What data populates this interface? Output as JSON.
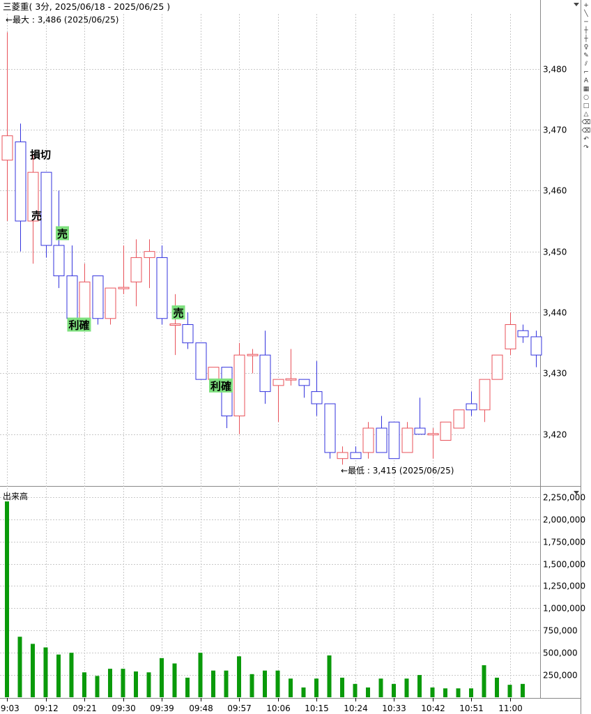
{
  "window": {
    "title": "三菱重( 3分, 2025/06/18 - 2025/06/25 )"
  },
  "colors": {
    "up": "#e8525a",
    "down": "#3333dd",
    "volume": "#0a9a0a",
    "signal_bg": "#7ee07e",
    "grid": "#c8c8c8"
  },
  "toolbar_icons": [
    "plus-icon",
    "line-icon",
    "diagonal-icon",
    "hline-icon",
    "vline-icon",
    "text-icon",
    "pen-icon",
    "channel-icon",
    "box-icon",
    "letter-a-icon",
    "grid-icon",
    "circle-icon",
    "rectangle-icon",
    "triangle-icon",
    "eraser-icon",
    "eraser-all-icon",
    "undo-icon",
    "redo-icon"
  ],
  "chart_data": [
    {
      "type": "candlestick",
      "title": "三菱重( 3分, 2025/06/18 - 2025/06/25 )",
      "y_ticks": [
        "3,480",
        "3,470",
        "3,460",
        "3,450",
        "3,440",
        "3,430",
        "3,420"
      ],
      "y_tick_values": [
        3480,
        3470,
        3460,
        3450,
        3440,
        3430,
        3420
      ],
      "ylim": [
        3411.5,
        3489
      ],
      "x_tick_labels": [
        "09:03",
        "09:12",
        "09:21",
        "09:30",
        "09:39",
        "09:48",
        "09:57",
        "10:06",
        "10:15",
        "10:24",
        "10:33",
        "10:42",
        "10:51",
        "11:00"
      ],
      "x_tick_index": [
        0,
        3,
        6,
        9,
        12,
        15,
        18,
        21,
        24,
        27,
        30,
        33,
        36,
        39
      ],
      "candles": [
        {
          "o": 3465,
          "h": 3486,
          "l": 3455,
          "c": 3469
        },
        {
          "o": 3468,
          "h": 3471,
          "l": 3450,
          "c": 3455
        },
        {
          "o": 3455,
          "h": 3466,
          "l": 3448,
          "c": 3463
        },
        {
          "o": 3463,
          "h": 3463,
          "l": 3449,
          "c": 3451
        },
        {
          "o": 3451,
          "h": 3460,
          "l": 3444,
          "c": 3446
        },
        {
          "o": 3446,
          "h": 3451,
          "l": 3439,
          "c": 3439
        },
        {
          "o": 3439,
          "h": 3448,
          "l": 3439,
          "c": 3445
        },
        {
          "o": 3446,
          "h": 3446,
          "l": 3438,
          "c": 3439
        },
        {
          "o": 3439,
          "h": 3444,
          "l": 3438,
          "c": 3444
        },
        {
          "o": 3444,
          "h": 3451,
          "l": 3443,
          "c": 3444
        },
        {
          "o": 3445,
          "h": 3452,
          "l": 3441,
          "c": 3449
        },
        {
          "o": 3449,
          "h": 3452,
          "l": 3444,
          "c": 3450
        },
        {
          "o": 3449,
          "h": 3451,
          "l": 3438,
          "c": 3439
        },
        {
          "o": 3438,
          "h": 3443,
          "l": 3433,
          "c": 3438
        },
        {
          "o": 3438,
          "h": 3440,
          "l": 3434,
          "c": 3435
        },
        {
          "o": 3435,
          "h": 3435,
          "l": 3429,
          "c": 3429
        },
        {
          "o": 3429,
          "h": 3431,
          "l": 3429,
          "c": 3431
        },
        {
          "o": 3431,
          "h": 3431,
          "l": 3421,
          "c": 3423
        },
        {
          "o": 3423,
          "h": 3435,
          "l": 3420,
          "c": 3433
        },
        {
          "o": 3433,
          "h": 3434,
          "l": 3430,
          "c": 3433
        },
        {
          "o": 3433,
          "h": 3437,
          "l": 3425,
          "c": 3427
        },
        {
          "o": 3428,
          "h": 3429,
          "l": 3422,
          "c": 3429
        },
        {
          "o": 3429,
          "h": 3434,
          "l": 3428,
          "c": 3429
        },
        {
          "o": 3429,
          "h": 3429,
          "l": 3426,
          "c": 3428
        },
        {
          "o": 3427,
          "h": 3432,
          "l": 3423,
          "c": 3425
        },
        {
          "o": 3425,
          "h": 3425,
          "l": 3416,
          "c": 3417
        },
        {
          "o": 3416,
          "h": 3418,
          "l": 3415,
          "c": 3417
        },
        {
          "o": 3417,
          "h": 3418,
          "l": 3416,
          "c": 3416
        },
        {
          "o": 3417,
          "h": 3422,
          "l": 3416,
          "c": 3421
        },
        {
          "o": 3421,
          "h": 3423,
          "l": 3417,
          "c": 3417
        },
        {
          "o": 3422,
          "h": 3422,
          "l": 3416,
          "c": 3416
        },
        {
          "o": 3417,
          "h": 3422,
          "l": 3417,
          "c": 3421
        },
        {
          "o": 3421,
          "h": 3426,
          "l": 3420,
          "c": 3420
        },
        {
          "o": 3420,
          "h": 3421,
          "l": 3416,
          "c": 3420
        },
        {
          "o": 3419,
          "h": 3421,
          "l": 3419,
          "c": 3422
        },
        {
          "o": 3421,
          "h": 3424,
          "l": 3421,
          "c": 3424
        },
        {
          "o": 3425,
          "h": 3427,
          "l": 3423,
          "c": 3424
        },
        {
          "o": 3424,
          "h": 3429,
          "l": 3422,
          "c": 3429
        },
        {
          "o": 3429,
          "h": 3433,
          "l": 3429,
          "c": 3433
        },
        {
          "o": 3434,
          "h": 3440,
          "l": 3433,
          "c": 3438
        },
        {
          "o": 3437,
          "h": 3438,
          "l": 3435,
          "c": 3436
        },
        {
          "o": 3436,
          "h": 3437,
          "l": 3431,
          "c": 3433
        }
      ],
      "annotations": [
        {
          "text": "←最大 : 3,486 (2025/06/25)",
          "candle": 0,
          "value": 3488,
          "kind": "max"
        },
        {
          "text": "←最低 : 3,415 (2025/06/25)",
          "candle": 26,
          "value": 3414,
          "kind": "min"
        },
        {
          "text": "損切",
          "candle": 2,
          "value": 3466,
          "kind": "plain"
        },
        {
          "text": "売",
          "candle": 2,
          "value": 3456,
          "kind": "plain"
        },
        {
          "text": "売",
          "candle": 4,
          "value": 3453,
          "kind": "signal"
        },
        {
          "text": "利確",
          "candle": 5,
          "value": 3438,
          "kind": "signal"
        },
        {
          "text": "売",
          "candle": 13,
          "value": 3440,
          "kind": "signal"
        },
        {
          "text": "利確",
          "candle": 16,
          "value": 3428,
          "kind": "signal"
        }
      ]
    },
    {
      "type": "bar",
      "title": "出来高",
      "y_ticks": [
        "2,250,000",
        "2,000,000",
        "1,750,000",
        "1,500,000",
        "1,250,000",
        "1,000,000",
        "750,000",
        "500,000",
        "250,000"
      ],
      "y_tick_values": [
        2250000,
        2000000,
        1750000,
        1500000,
        1250000,
        1000000,
        750000,
        500000,
        250000
      ],
      "ylim": [
        0,
        2350000
      ],
      "values": [
        2200000,
        680000,
        600000,
        560000,
        480000,
        500000,
        280000,
        240000,
        320000,
        320000,
        290000,
        280000,
        440000,
        380000,
        220000,
        500000,
        300000,
        300000,
        460000,
        260000,
        300000,
        300000,
        210000,
        110000,
        210000,
        470000,
        220000,
        150000,
        110000,
        210000,
        150000,
        210000,
        250000,
        110000,
        100000,
        100000,
        100000,
        360000,
        220000,
        140000,
        150000
      ]
    }
  ]
}
